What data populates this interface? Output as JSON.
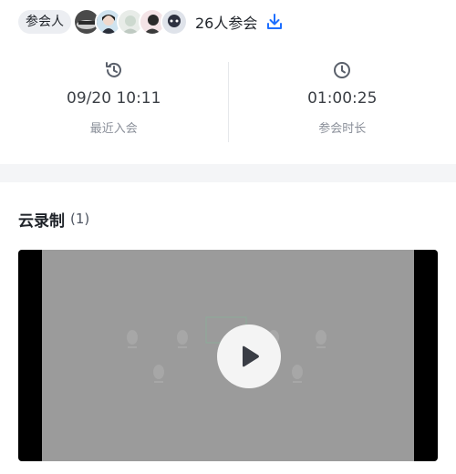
{
  "participants": {
    "tag_label": "参会人",
    "count_label": "26人参会",
    "avatars": [
      "avatar-1",
      "avatar-2",
      "avatar-3",
      "avatar-4",
      "avatar-5"
    ]
  },
  "stats": {
    "join_time": {
      "icon": "history-icon",
      "value": "09/20 10:11",
      "label": "最近入会"
    },
    "duration": {
      "icon": "clock-icon",
      "value": "01:00:25",
      "label": "参会时长"
    }
  },
  "cloud_recording": {
    "title": "云录制",
    "count": "(1)"
  },
  "colors": {
    "accent": "#1e6fff",
    "video_bg": "#9b9b9b",
    "band_bg": "#f4f5f7"
  }
}
